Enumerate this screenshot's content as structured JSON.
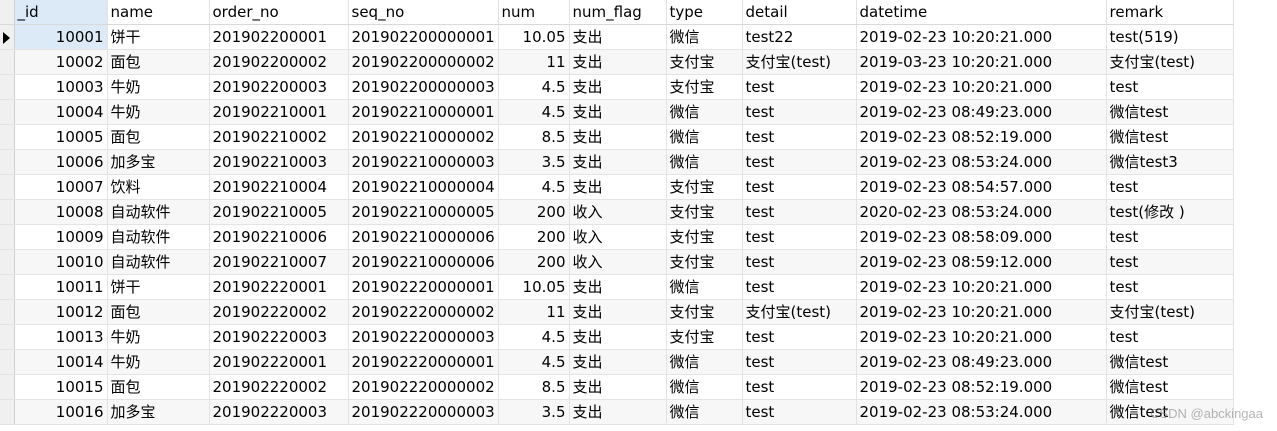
{
  "columns": [
    "_id",
    "name",
    "order_no",
    "seq_no",
    "num",
    "num_flag",
    "type",
    "detail",
    "datetime",
    "remark"
  ],
  "rows": [
    [
      "10001",
      "饼干",
      "201902200001",
      "201902200000001",
      "10.05",
      "支出",
      "微信",
      "test22",
      "2019-02-23 10:20:21.000",
      "test(519)"
    ],
    [
      "10002",
      "面包",
      "201902200002",
      "201902200000002",
      "11",
      "支出",
      "支付宝",
      "支付宝(test)",
      "2019-03-23 10:20:21.000",
      "支付宝(test)"
    ],
    [
      "10003",
      "牛奶",
      "201902200003",
      "201902200000003",
      "4.5",
      "支出",
      "支付宝",
      "test",
      "2019-02-23 10:20:21.000",
      "test"
    ],
    [
      "10004",
      "牛奶",
      "201902210001",
      "201902210000001",
      "4.5",
      "支出",
      "微信",
      "test",
      "2019-02-23 08:49:23.000",
      "微信test"
    ],
    [
      "10005",
      "面包",
      "201902210002",
      "201902210000002",
      "8.5",
      "支出",
      "微信",
      "test",
      "2019-02-23 08:52:19.000",
      "微信test"
    ],
    [
      "10006",
      "加多宝",
      "201902210003",
      "201902210000003",
      "3.5",
      "支出",
      "微信",
      "test",
      "2019-02-23 08:53:24.000",
      "微信test3"
    ],
    [
      "10007",
      "饮料",
      "201902210004",
      "201902210000004",
      "4.5",
      "支出",
      "支付宝",
      "test",
      "2019-02-23 08:54:57.000",
      "test"
    ],
    [
      "10008",
      "自动软件",
      "201902210005",
      "201902210000005",
      "200",
      "收入",
      "支付宝",
      "test",
      "2020-02-23 08:53:24.000",
      "test(修改 )"
    ],
    [
      "10009",
      "自动软件",
      "201902210006",
      "201902210000006",
      "200",
      "收入",
      "支付宝",
      "test",
      "2019-02-23 08:58:09.000",
      "test"
    ],
    [
      "10010",
      "自动软件",
      "201902210007",
      "201902210000006",
      "200",
      "收入",
      "支付宝",
      "test",
      "2019-02-23 08:59:12.000",
      "test"
    ],
    [
      "10011",
      "饼干",
      "201902220001",
      "201902220000001",
      "10.05",
      "支出",
      "微信",
      "test",
      "2019-02-23 10:20:21.000",
      "test"
    ],
    [
      "10012",
      "面包",
      "201902220002",
      "201902220000002",
      "11",
      "支出",
      "支付宝",
      "支付宝(test)",
      "2019-02-23 10:20:21.000",
      "支付宝(test)"
    ],
    [
      "10013",
      "牛奶",
      "201902220003",
      "201902220000003",
      "4.5",
      "支出",
      "支付宝",
      "test",
      "2019-02-23 10:20:21.000",
      "test"
    ],
    [
      "10014",
      "牛奶",
      "201902220001",
      "201902220000001",
      "4.5",
      "支出",
      "微信",
      "test",
      "2019-02-23 08:49:23.000",
      "微信test"
    ],
    [
      "10015",
      "面包",
      "201902220002",
      "201902220000002",
      "8.5",
      "支出",
      "微信",
      "test",
      "2019-02-23 08:52:19.000",
      "微信test"
    ],
    [
      "10016",
      "加多宝",
      "201902220003",
      "201902220000003",
      "3.5",
      "支出",
      "微信",
      "test",
      "2019-02-23 08:53:24.000",
      "微信test"
    ]
  ],
  "current_row_index": 0,
  "current_row_icon": "row-pointer-icon",
  "watermark": "CSDN @abckingaa",
  "colors": {
    "selection": "#dceaf8",
    "grid_line": "#e3e3e3",
    "indicator_bg": "#f0f0f0"
  }
}
